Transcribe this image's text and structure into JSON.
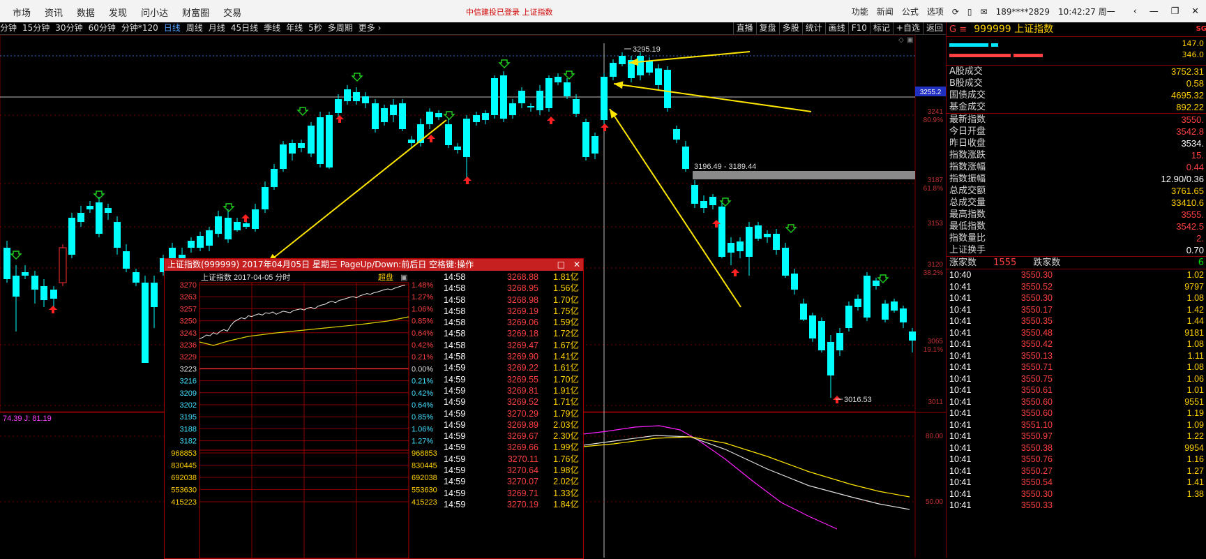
{
  "topbar": {
    "menu": [
      "市场",
      "资讯",
      "数据",
      "发现",
      "问小达",
      "财富圈",
      "交易"
    ],
    "login_notice": "中信建投已登录  上证指数",
    "right_items": [
      "功能",
      "新闻",
      "公式",
      "选项"
    ],
    "phone": "189****2829",
    "clock": "10:42:27 周一",
    "window_controls": [
      "‹",
      "—",
      "❐",
      "✕"
    ]
  },
  "periodbar": {
    "periods": [
      "分钟",
      "15分钟",
      "30分钟",
      "60分钟",
      "分钟*120",
      "日线",
      "周线",
      "月线",
      "45日线",
      "季线",
      "年线",
      "5秒",
      "多周期",
      "更多 ›"
    ],
    "active": "日线",
    "tools": [
      "直播",
      "复盘",
      "多股",
      "统计",
      "画线",
      "F10",
      "标记",
      "+自选",
      "返回"
    ]
  },
  "chart_labels": {
    "high_label": "3295.19",
    "low_label": "3016.53",
    "range_label": "3196.49 - 3189.44",
    "crosshair_price": "3255.2",
    "price_ticks": [
      {
        "price": "3241",
        "pct": "80.9%"
      },
      {
        "price": "3187",
        "pct": "61.8%"
      },
      {
        "price": "3153",
        "pct": ""
      },
      {
        "price": "3120",
        "pct": "38.2%"
      },
      {
        "price": "3065",
        "pct": "19.1%"
      },
      {
        "price": "3011",
        "pct": ""
      }
    ],
    "kdj_text": "74.39  J: 81.19",
    "kdj_ticks": [
      "80.00",
      "50.00"
    ]
  },
  "popup": {
    "title": "上证指数(999999) 2017年04月05日 星期三 PageUp/Down:前后日 空格键:操作",
    "subtitle": "上证指数  2017-04-05 分时",
    "mode": "超盘",
    "price_axis": [
      "3270",
      "3263",
      "3257",
      "3250",
      "3243",
      "3236",
      "3229",
      "3223",
      "3216",
      "3209",
      "3202",
      "3195",
      "3188",
      "3182"
    ],
    "pct_axis": [
      "1.48%",
      "1.27%",
      "1.06%",
      "0.85%",
      "0.64%",
      "0.42%",
      "0.21%",
      "0.00%",
      "0.21%",
      "0.42%",
      "0.64%",
      "0.85%",
      "1.06%",
      "1.27%"
    ],
    "vol_axis": [
      "968853",
      "830445",
      "692038",
      "553630",
      "415223"
    ],
    "ticks": [
      [
        "14:58",
        "3268.88",
        "1.81亿"
      ],
      [
        "14:58",
        "3268.95",
        "1.56亿"
      ],
      [
        "14:58",
        "3268.98",
        "1.70亿"
      ],
      [
        "14:58",
        "3269.19",
        "1.75亿"
      ],
      [
        "14:58",
        "3269.06",
        "1.59亿"
      ],
      [
        "14:58",
        "3269.18",
        "1.72亿"
      ],
      [
        "14:58",
        "3269.47",
        "1.67亿"
      ],
      [
        "14:58",
        "3269.90",
        "1.41亿"
      ],
      [
        "14:59",
        "3269.22",
        "1.61亿"
      ],
      [
        "14:59",
        "3269.55",
        "1.70亿"
      ],
      [
        "14:59",
        "3269.81",
        "1.91亿"
      ],
      [
        "14:59",
        "3269.52",
        "1.71亿"
      ],
      [
        "14:59",
        "3270.29",
        "1.79亿"
      ],
      [
        "14:59",
        "3269.89",
        "2.03亿"
      ],
      [
        "14:59",
        "3269.67",
        "2.30亿"
      ],
      [
        "14:59",
        "3269.66",
        "1.99亿"
      ],
      [
        "14:59",
        "3270.11",
        "1.76亿"
      ],
      [
        "14:59",
        "3270.64",
        "1.98亿"
      ],
      [
        "14:59",
        "3270.07",
        "2.02亿"
      ],
      [
        "14:59",
        "3269.71",
        "1.33亿"
      ],
      [
        "14:59",
        "3270.19",
        "1.84亿"
      ]
    ]
  },
  "rightpanel": {
    "g": "G ≡",
    "code": "999999 上证指数",
    "sg": "SG",
    "bar_values": [
      "147.0",
      "346.0"
    ],
    "group1": [
      {
        "k": "A股成交",
        "v": "3752.31",
        "c": "#ffd000"
      },
      {
        "k": "B股成交",
        "v": "0.58",
        "c": "#ffd000"
      },
      {
        "k": "国债成交",
        "v": "4695.32",
        "c": "#ffd000"
      },
      {
        "k": "基金成交",
        "v": "892.22",
        "c": "#ffd000"
      }
    ],
    "group2": [
      {
        "k": "最新指数",
        "v": "3550.",
        "c": "#ff4040"
      },
      {
        "k": "今日开盘",
        "v": "3542.8",
        "c": "#ff4040"
      },
      {
        "k": "昨日收盘",
        "v": "3534.",
        "c": "#ffffff"
      },
      {
        "k": "指数涨跌",
        "v": "15.",
        "c": "#ff4040"
      },
      {
        "k": "指数涨幅",
        "v": "0.44",
        "c": "#ff4040"
      },
      {
        "k": "指数振幅",
        "v": "12.90/0.36",
        "c": "#ffffff"
      },
      {
        "k": "总成交额",
        "v": "3761.65",
        "c": "#ffd000"
      },
      {
        "k": "总成交量",
        "v": "33410.6",
        "c": "#ffd000"
      },
      {
        "k": "最高指数",
        "v": "3555.",
        "c": "#ff4040"
      },
      {
        "k": "最低指数",
        "v": "3542.5",
        "c": "#ff4040"
      },
      {
        "k": "指数量比",
        "v": "2.",
        "c": "#ff4040"
      },
      {
        "k": "上证换手",
        "v": "0.70",
        "c": "#ffffff"
      }
    ],
    "updown": {
      "up_label": "涨家数",
      "up_val": "1555",
      "down_label": "跌家数",
      "down_val": "6"
    },
    "ticks": [
      [
        "10:40",
        "3550.30",
        "1.02"
      ],
      [
        "10:41",
        "3550.52",
        "9797"
      ],
      [
        "10:41",
        "3550.30",
        "1.08"
      ],
      [
        "10:41",
        "3550.17",
        "1.42"
      ],
      [
        "10:41",
        "3550.35",
        "1.44"
      ],
      [
        "10:41",
        "3550.48",
        "9181"
      ],
      [
        "10:41",
        "3550.42",
        "1.08"
      ],
      [
        "10:41",
        "3550.13",
        "1.11"
      ],
      [
        "10:41",
        "3550.71",
        "1.08"
      ],
      [
        "10:41",
        "3550.75",
        "1.06"
      ],
      [
        "10:41",
        "3550.61",
        "1.01"
      ],
      [
        "10:41",
        "3550.60",
        "9551"
      ],
      [
        "10:41",
        "3550.60",
        "1.19"
      ],
      [
        "10:41",
        "3551.10",
        "1.09"
      ],
      [
        "10:41",
        "3550.97",
        "1.22"
      ],
      [
        "10:41",
        "3550.38",
        "9954"
      ],
      [
        "10:41",
        "3550.76",
        "1.16"
      ],
      [
        "10:41",
        "3550.27",
        "1.27"
      ],
      [
        "10:41",
        "3550.54",
        "1.41"
      ],
      [
        "10:41",
        "3550.30",
        "1.38"
      ],
      [
        "10:41",
        "3550.33",
        ""
      ]
    ]
  },
  "colors": {
    "up": "#ff3030",
    "down": "#00ffff",
    "yellow": "#ffe600",
    "grid": "#7a0000"
  }
}
